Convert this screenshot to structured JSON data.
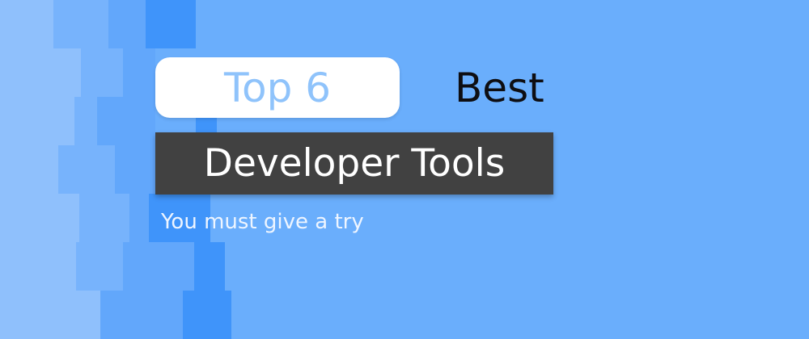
{
  "banner": {
    "top_label": "Top 6",
    "best_label": "Best",
    "main_title": "Developer Tools",
    "subtitle": "You must give a try"
  },
  "colors": {
    "background": "#6aaefc",
    "top_box": "#ffffff",
    "top_text": "#8fc3fb",
    "main_box": "#414141",
    "main_text": "#ffffff",
    "best_text": "#0e0e12",
    "subtitle_text": "#eef5ff",
    "stripe_deep": "#3f94fa",
    "stripe_far": "#8fc0fc"
  }
}
